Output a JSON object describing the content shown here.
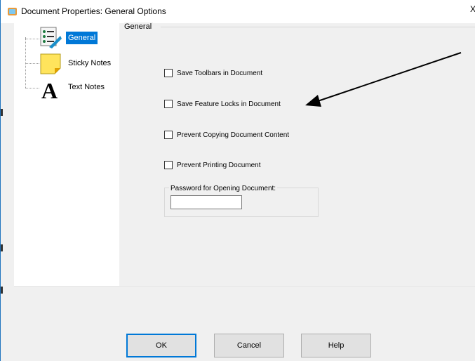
{
  "window": {
    "title": "Document Properties: General Options",
    "close_glyph": "X"
  },
  "tree": {
    "items": [
      {
        "label": "General",
        "icon": "general-settings-icon",
        "selected": true
      },
      {
        "label": "Sticky Notes",
        "icon": "sticky-note-icon",
        "selected": false
      },
      {
        "label": "Text Notes",
        "icon": "text-note-icon",
        "selected": false
      }
    ]
  },
  "general": {
    "group_title": "General",
    "options": [
      {
        "label": "Save Toolbars in Document",
        "checked": false
      },
      {
        "label": "Save Feature Locks in Document",
        "checked": false
      },
      {
        "label": "Prevent Copying Document Content",
        "checked": false
      },
      {
        "label": "Prevent Printing Document",
        "checked": false
      }
    ],
    "password_group_label": "Password for Opening Document:",
    "password_value": ""
  },
  "buttons": {
    "ok": "OK",
    "cancel": "Cancel",
    "help": "Help"
  },
  "colors": {
    "selection": "#0078d7",
    "window_border": "#1e73be",
    "dialog_bg": "#f0f0f0",
    "annotation_arrow": "#000000"
  }
}
